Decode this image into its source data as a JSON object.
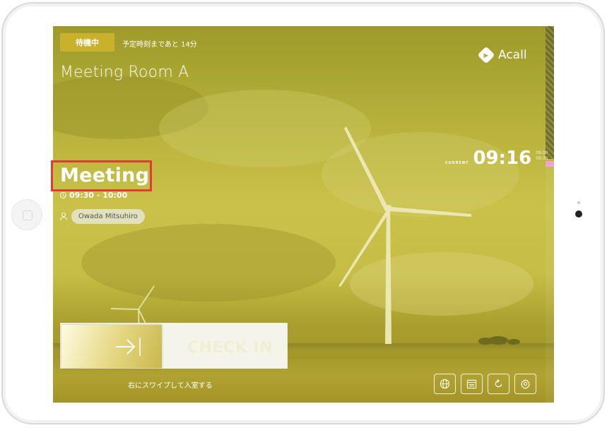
{
  "status": {
    "badge": "待機中",
    "next_start": "予定時刻まであと 14分"
  },
  "room": {
    "name": "Meeting Room A"
  },
  "brand": {
    "name": "Acall"
  },
  "clock": {
    "label": "CURRENT",
    "time": "09:16",
    "small_top": "09:00",
    "small_bottom": "09:30"
  },
  "meeting": {
    "title": "Meeting",
    "time_range": "09:30 - 10:00",
    "organizer": "Owada Mitsuhiro"
  },
  "checkin": {
    "label": "CHECK IN",
    "hint": "右にスワイプして入室する"
  },
  "toolbar": {
    "icons": [
      "globe-icon",
      "calendar-icon",
      "refresh-icon",
      "gear-icon"
    ]
  },
  "colors": {
    "overlay": "#c9c24a",
    "badge": "#c9b12c",
    "highlight": "#e53935",
    "timeline_marker": "#f0a3d2"
  }
}
